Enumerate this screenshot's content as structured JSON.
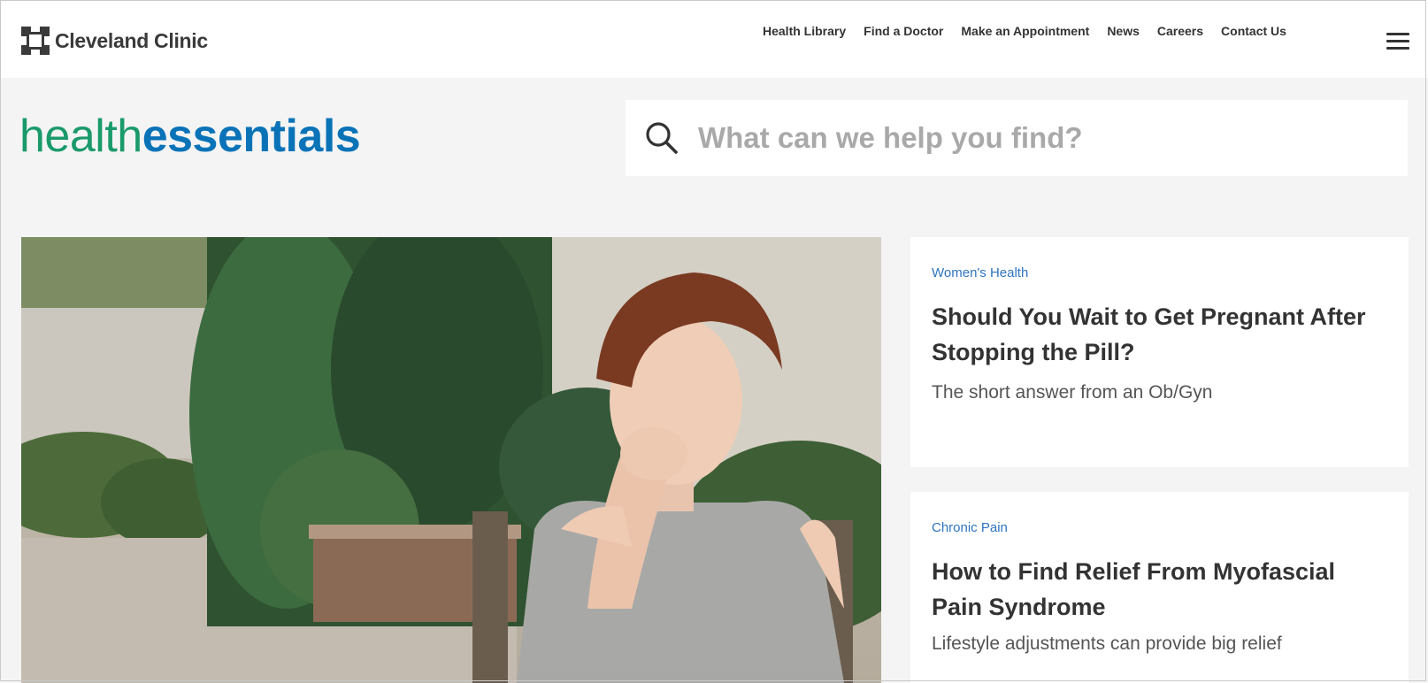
{
  "header": {
    "logo_text": "Cleveland Clinic",
    "nav": [
      "Health Library",
      "Find a Doctor",
      "Make an Appointment",
      "News",
      "Careers",
      "Contact Us"
    ]
  },
  "brand": {
    "part1": "health",
    "part2": "essentials"
  },
  "search": {
    "placeholder": "What can we help you find?"
  },
  "articles": [
    {
      "category": "Women's Health",
      "title": "Should You Wait to Get Pregnant After Stopping the Pill?",
      "subtitle": "The short answer from an Ob/Gyn"
    },
    {
      "category": "Chronic Pain",
      "title": "How to Find Relief From Myofascial Pain Syndrome",
      "subtitle": "Lifestyle adjustments can provide big relief"
    }
  ],
  "colors": {
    "brand_green": "#1a9a6b",
    "brand_blue": "#0a73b8",
    "category_blue": "#2e74c0"
  },
  "icons": [
    "cleveland-clinic-logo-icon",
    "search-icon",
    "hamburger-menu-icon"
  ]
}
